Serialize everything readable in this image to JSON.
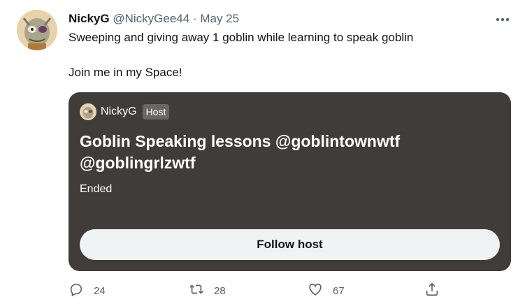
{
  "tweet": {
    "author_name": "NickyG",
    "handle": "@NickyGee44",
    "separator": "·",
    "date": "May 25",
    "line1": "Sweeping and giving away 1 goblin while learning to speak goblin",
    "line2": "Join me in my Space!"
  },
  "space_card": {
    "host_name": "NickyG",
    "host_badge": "Host",
    "title": "Goblin Speaking lessons @goblintownwtf @goblingrlzwtf",
    "status": "Ended",
    "follow_label": "Follow host"
  },
  "actions": {
    "replies": "24",
    "retweets": "28",
    "likes": "67"
  },
  "icons": [
    "more-icon",
    "reply-icon",
    "retweet-icon",
    "like-icon",
    "share-icon"
  ],
  "colors": {
    "card_bg": "#403c39",
    "muted_text": "#536471",
    "button_bg": "#eff3f4"
  }
}
